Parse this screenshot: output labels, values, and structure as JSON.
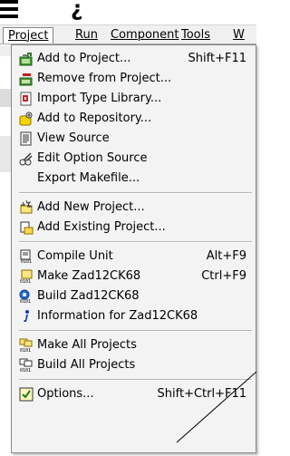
{
  "top_glyph": "¿",
  "menubar": {
    "items": [
      {
        "label": "Project",
        "active": true
      },
      {
        "label": "Run"
      },
      {
        "label": "Component"
      },
      {
        "label": "Tools"
      },
      {
        "label": "W"
      }
    ]
  },
  "menu": {
    "items": [
      {
        "label": "Add to Project...",
        "shortcut": "Shift+F11",
        "icon": "add-to-project-icon"
      },
      {
        "label": "Remove from Project...",
        "shortcut": "",
        "icon": "remove-from-project-icon"
      },
      {
        "label": "Import Type Library...",
        "shortcut": "",
        "icon": "import-type-library-icon"
      },
      {
        "label": "Add to Repository...",
        "shortcut": "",
        "icon": "add-to-repository-icon"
      },
      {
        "label": "View Source",
        "shortcut": "",
        "icon": "view-source-icon"
      },
      {
        "label": "Edit Option Source",
        "shortcut": "",
        "icon": "edit-option-source-icon"
      },
      {
        "label": "Export Makefile...",
        "shortcut": "",
        "icon": ""
      },
      {
        "label": "Add New Project...",
        "shortcut": "",
        "icon": "add-new-project-icon"
      },
      {
        "label": "Add Existing Project...",
        "shortcut": "",
        "icon": "add-existing-project-icon"
      },
      {
        "label": "Compile Unit",
        "shortcut": "Alt+F9",
        "icon": "compile-unit-icon"
      },
      {
        "label": "Make Zad12CK68",
        "shortcut": "Ctrl+F9",
        "icon": "make-icon"
      },
      {
        "label": "Build Zad12CK68",
        "shortcut": "",
        "icon": "build-icon"
      },
      {
        "label": "Information for Zad12CK68",
        "shortcut": "",
        "icon": "information-icon"
      },
      {
        "label": "Make All Projects",
        "shortcut": "",
        "icon": "make-all-projects-icon"
      },
      {
        "label": "Build All Projects",
        "shortcut": "",
        "icon": "build-all-projects-icon"
      },
      {
        "label": "Options...",
        "shortcut": "Shift+Ctrl+F11",
        "icon": "options-icon"
      }
    ]
  }
}
